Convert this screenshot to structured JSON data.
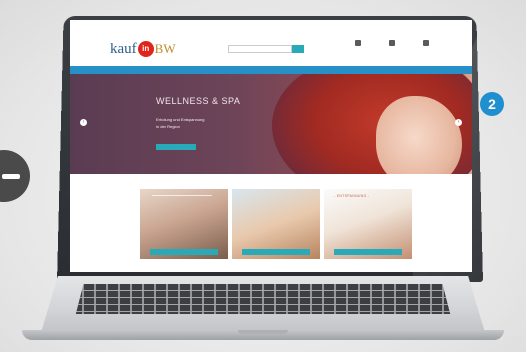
{
  "step_badge_number": "2",
  "website": {
    "logo": {
      "text_before": "kauf",
      "badge": "in",
      "text_after": "BW"
    },
    "hero": {
      "title": "WELLNESS & SPA",
      "subtitle_line1": "Erholung und Entspannung",
      "subtitle_line2": "in der Region"
    },
    "tile3_tag": "- ENTSPANNUNG -"
  },
  "colors": {
    "accent_teal": "#29aab8",
    "nav_blue": "#2790c6",
    "step_badge_blue": "#1f8fcf",
    "logo_badge_red": "#e0241b"
  },
  "icons": [
    "minus-icon",
    "location-icon",
    "user-icon",
    "cart-icon",
    "chevron-left-icon",
    "chevron-right-icon"
  ]
}
